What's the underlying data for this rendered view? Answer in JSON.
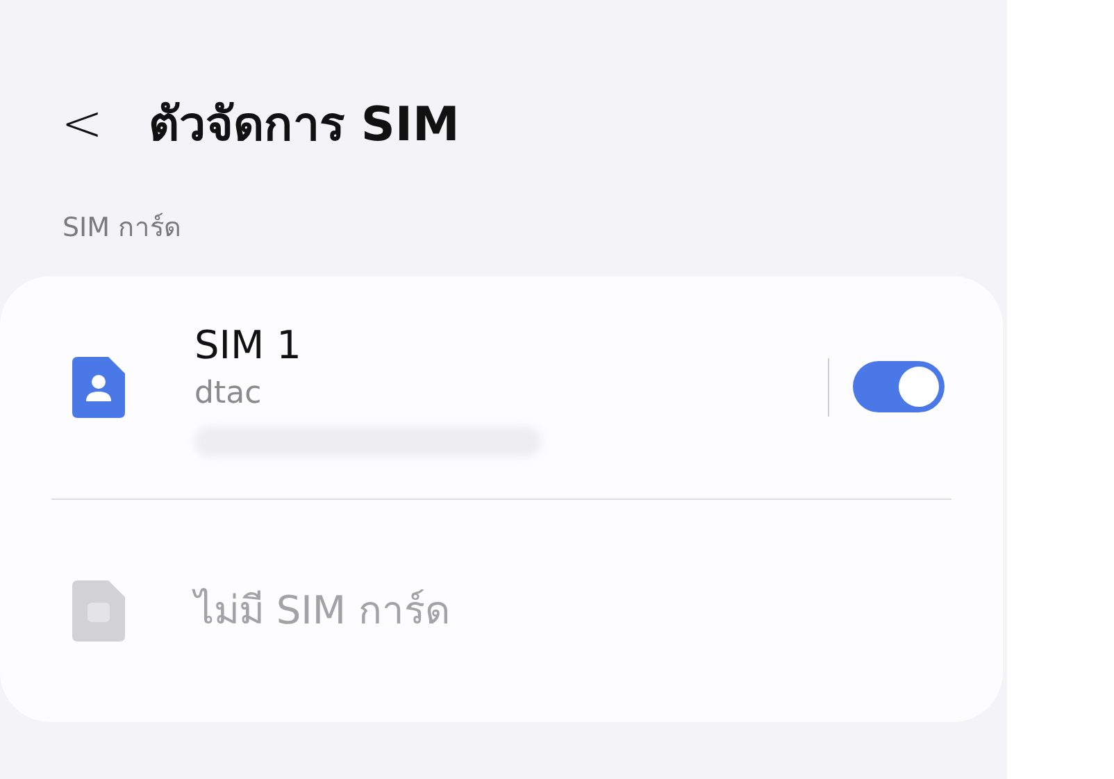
{
  "header": {
    "back": "<",
    "title": "ตัวจัดการ SIM"
  },
  "section": {
    "label": "SIM การ์ด"
  },
  "items": [
    {
      "kind": "sim",
      "title": "SIM 1",
      "subtitle": "dtac",
      "on": true,
      "disabled": false
    },
    {
      "kind": "empty",
      "title": "ไม่มี SIM การ์ด",
      "disabled": true
    }
  ]
}
